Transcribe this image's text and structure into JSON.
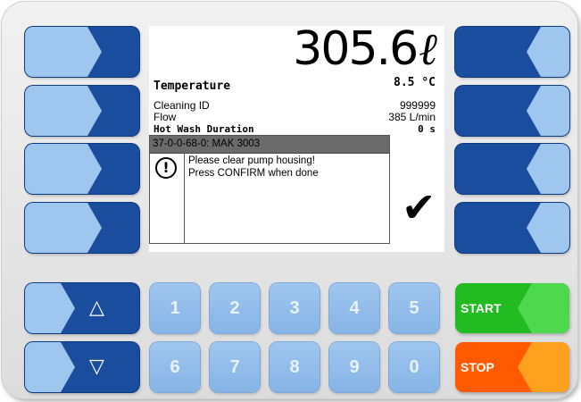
{
  "display": {
    "volume": "305.6",
    "volume_unit": "ℓ",
    "temperature_label": "Temperature",
    "temperature_value": "8.5 °C",
    "rows": [
      {
        "label": "Cleaning ID",
        "value": "999999"
      },
      {
        "label": "Flow",
        "value": "385 L/min"
      },
      {
        "label": "Hot Wash Duration",
        "value": "0 s"
      }
    ]
  },
  "dialog": {
    "title": "37-0-0-68-0: MAK 3003",
    "icon": "!",
    "line1": "Please clear pump housing!",
    "line2": "Press CONFIRM when done",
    "confirm_glyph": "✔"
  },
  "keys": {
    "up_glyph": "△",
    "down_glyph": "▽",
    "numbers_top": [
      "1",
      "2",
      "3",
      "4",
      "5"
    ],
    "numbers_bottom": [
      "6",
      "7",
      "8",
      "9",
      "0"
    ],
    "start": "START",
    "stop": "STOP"
  },
  "colors": {
    "softkey_dark": "#1a4d9e",
    "softkey_light": "#9fc6ef",
    "start": "#22bb22",
    "stop": "#ff5a00"
  }
}
